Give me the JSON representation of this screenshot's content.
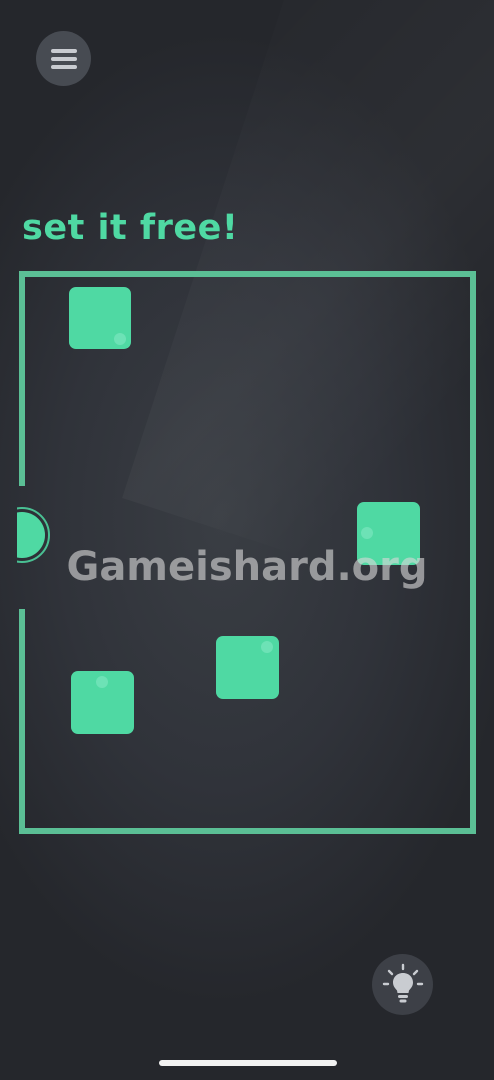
{
  "game": {
    "title": "set it free!",
    "accent_color": "#4fd9a3",
    "border_color": "#5bbf95",
    "background_color": "#2f3237"
  },
  "controls": {
    "menu_icon": "hamburger-menu-icon",
    "hint_icon": "lightbulb-icon"
  },
  "board": {
    "blocks": 4,
    "ball": 1,
    "exit_side": "left"
  },
  "watermark": {
    "text": "Gameishard.org"
  }
}
